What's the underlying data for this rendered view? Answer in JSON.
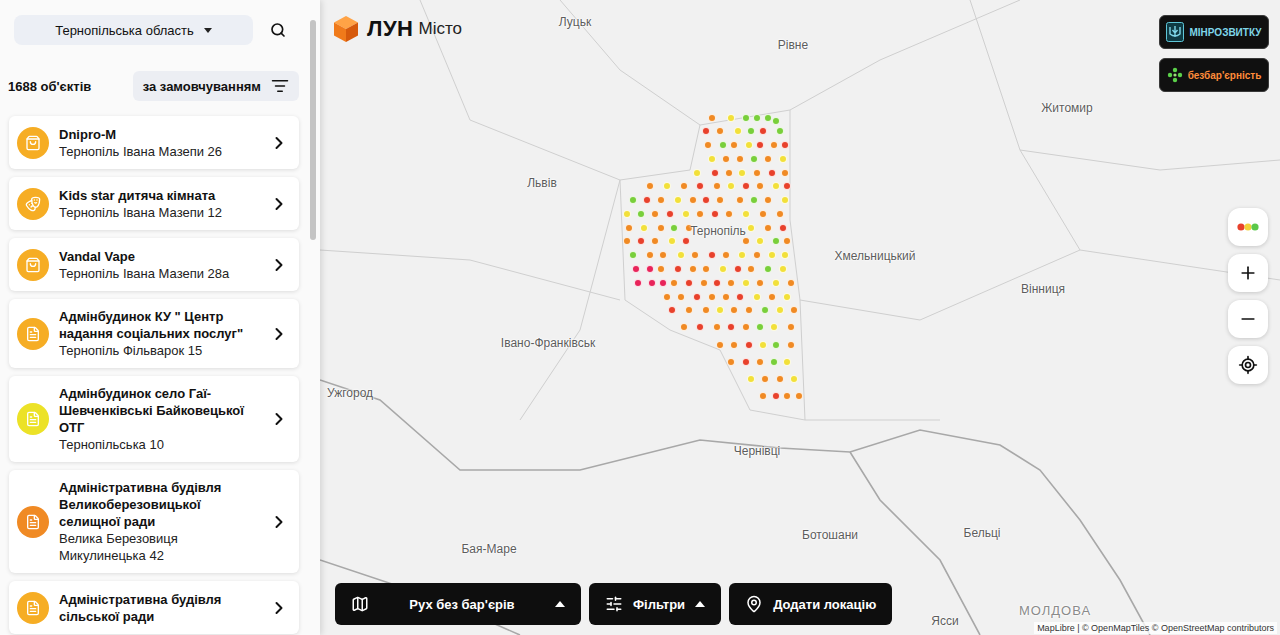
{
  "sidebar": {
    "region_select": {
      "value": "Тернопільська область"
    },
    "count": "1688 об'єктів",
    "sort": {
      "label": "за замовчуванням"
    },
    "items": [
      {
        "title": "Dnipro-M",
        "address": "Тернопіль Івана Мазепи 26",
        "color": "#f6ad24",
        "kind": "shop"
      },
      {
        "title": "Kids star дитяча кімната",
        "address": "Тернопіль Івана Мазепи 12",
        "color": "#f6ad24",
        "kind": "kids"
      },
      {
        "title": "Vandal Vape",
        "address": "Тернопіль Івана Мазепи 28а",
        "color": "#f6ad24",
        "kind": "shop"
      },
      {
        "title": "Адмінбудинок КУ \" Центр надання соціальних послуг\"",
        "address": "Тернопіль Фільварок 15",
        "color": "#f6ad24",
        "kind": "admin"
      },
      {
        "title": "Адмінбудинок село Гаї-Шевченківські Байковецької ОТГ",
        "address": "Тернопільська 10",
        "color": "#ece227",
        "kind": "admin"
      },
      {
        "title": "Адміністративна будівля Великоберезовицької селищної ради",
        "address": "Велика Березовиця Микулинецька 42",
        "color": "#f08a24",
        "kind": "admin"
      },
      {
        "title": "Адміністративна будівля сільської ради",
        "address": "",
        "color": "#f6ad24",
        "kind": "admin"
      }
    ]
  },
  "map": {
    "logo": {
      "brand": "ЛУН",
      "product": "Місто"
    },
    "badges": [
      {
        "label": "МІНРОЗВИТКУ",
        "kind": "ministry"
      },
      {
        "label": "безбар'єрність",
        "kind": "barrierfree"
      }
    ],
    "labels": [
      {
        "text": "Луцьк",
        "kind": "city"
      },
      {
        "text": "Рівне",
        "kind": "city"
      },
      {
        "text": "Житомир",
        "kind": "city"
      },
      {
        "text": "Львів",
        "kind": "city"
      },
      {
        "text": "Тернопіль",
        "kind": "city"
      },
      {
        "text": "Хмельницький",
        "kind": "city"
      },
      {
        "text": "Вінниця",
        "kind": "city"
      },
      {
        "text": "Івано-Франківськ",
        "kind": "city"
      },
      {
        "text": "Ужгород",
        "kind": "city"
      },
      {
        "text": "Чернівці",
        "kind": "city"
      },
      {
        "text": "Бая-Маре",
        "kind": "city"
      },
      {
        "text": "Ботошани",
        "kind": "city"
      },
      {
        "text": "Бельці",
        "kind": "city"
      },
      {
        "text": "Ясси",
        "kind": "city"
      },
      {
        "text": "МОЛДОВА",
        "kind": "country"
      }
    ],
    "dots": [
      {
        "lon": 25.55,
        "lat": 50.22,
        "color": "#f08a24"
      },
      {
        "lon": 25.72,
        "lat": 50.22,
        "color": "#f2e03a"
      },
      {
        "lon": 25.85,
        "lat": 50.22,
        "color": "#79cf3b"
      },
      {
        "lon": 25.95,
        "lat": 50.22,
        "color": "#79cf3b"
      },
      {
        "lon": 26.05,
        "lat": 50.22,
        "color": "#79cf3b"
      },
      {
        "lon": 26.12,
        "lat": 50.2,
        "color": "#79cf3b"
      },
      {
        "lon": 25.5,
        "lat": 50.14,
        "color": "#e8412c"
      },
      {
        "lon": 25.62,
        "lat": 50.14,
        "color": "#f08a24"
      },
      {
        "lon": 25.78,
        "lat": 50.14,
        "color": "#f2e03a"
      },
      {
        "lon": 25.9,
        "lat": 50.14,
        "color": "#79cf3b"
      },
      {
        "lon": 26.0,
        "lat": 50.14,
        "color": "#e8412c"
      },
      {
        "lon": 26.15,
        "lat": 50.14,
        "color": "#79cf3b"
      },
      {
        "lon": 25.52,
        "lat": 50.06,
        "color": "#f08a24"
      },
      {
        "lon": 25.65,
        "lat": 50.06,
        "color": "#79cf3b"
      },
      {
        "lon": 25.75,
        "lat": 50.06,
        "color": "#f08a24"
      },
      {
        "lon": 25.88,
        "lat": 50.06,
        "color": "#f2e03a"
      },
      {
        "lon": 25.98,
        "lat": 50.06,
        "color": "#e8412c"
      },
      {
        "lon": 26.1,
        "lat": 50.06,
        "color": "#f08a24"
      },
      {
        "lon": 26.2,
        "lat": 50.06,
        "color": "#e8412c"
      },
      {
        "lon": 25.55,
        "lat": 49.98,
        "color": "#f2e03a"
      },
      {
        "lon": 25.68,
        "lat": 49.98,
        "color": "#f08a24"
      },
      {
        "lon": 25.8,
        "lat": 49.98,
        "color": "#f08a24"
      },
      {
        "lon": 25.92,
        "lat": 49.98,
        "color": "#79cf3b"
      },
      {
        "lon": 26.05,
        "lat": 49.98,
        "color": "#f08a24"
      },
      {
        "lon": 26.18,
        "lat": 49.98,
        "color": "#f2e03a"
      },
      {
        "lon": 25.42,
        "lat": 49.9,
        "color": "#f2e03a"
      },
      {
        "lon": 25.58,
        "lat": 49.9,
        "color": "#e8412c"
      },
      {
        "lon": 25.7,
        "lat": 49.9,
        "color": "#f08a24"
      },
      {
        "lon": 25.82,
        "lat": 49.9,
        "color": "#f2e03a"
      },
      {
        "lon": 25.95,
        "lat": 49.9,
        "color": "#f08a24"
      },
      {
        "lon": 26.08,
        "lat": 49.9,
        "color": "#e8412c"
      },
      {
        "lon": 26.2,
        "lat": 49.9,
        "color": "#f08a24"
      },
      {
        "lon": 25.0,
        "lat": 49.82,
        "color": "#f08a24"
      },
      {
        "lon": 25.15,
        "lat": 49.82,
        "color": "#f2e03a"
      },
      {
        "lon": 25.3,
        "lat": 49.82,
        "color": "#f08a24"
      },
      {
        "lon": 25.45,
        "lat": 49.82,
        "color": "#e8412c"
      },
      {
        "lon": 25.6,
        "lat": 49.82,
        "color": "#f08a24"
      },
      {
        "lon": 25.72,
        "lat": 49.82,
        "color": "#f2e03a"
      },
      {
        "lon": 25.85,
        "lat": 49.82,
        "color": "#e8412c"
      },
      {
        "lon": 25.98,
        "lat": 49.82,
        "color": "#f08a24"
      },
      {
        "lon": 26.12,
        "lat": 49.82,
        "color": "#f2e03a"
      },
      {
        "lon": 26.22,
        "lat": 49.82,
        "color": "#e8412c"
      },
      {
        "lon": 24.85,
        "lat": 49.74,
        "color": "#79cf3b"
      },
      {
        "lon": 24.98,
        "lat": 49.74,
        "color": "#e8412c"
      },
      {
        "lon": 25.1,
        "lat": 49.74,
        "color": "#f08a24"
      },
      {
        "lon": 25.25,
        "lat": 49.74,
        "color": "#f2e03a"
      },
      {
        "lon": 25.38,
        "lat": 49.74,
        "color": "#f08a24"
      },
      {
        "lon": 25.5,
        "lat": 49.74,
        "color": "#e8412c"
      },
      {
        "lon": 25.62,
        "lat": 49.74,
        "color": "#f08a24"
      },
      {
        "lon": 25.8,
        "lat": 49.74,
        "color": "#f08a24"
      },
      {
        "lon": 25.92,
        "lat": 49.74,
        "color": "#79cf3b"
      },
      {
        "lon": 26.05,
        "lat": 49.74,
        "color": "#f08a24"
      },
      {
        "lon": 26.2,
        "lat": 49.74,
        "color": "#f2e03a"
      },
      {
        "lon": 24.8,
        "lat": 49.66,
        "color": "#f2e03a"
      },
      {
        "lon": 24.92,
        "lat": 49.66,
        "color": "#79cf3b"
      },
      {
        "lon": 25.05,
        "lat": 49.66,
        "color": "#f08a24"
      },
      {
        "lon": 25.18,
        "lat": 49.66,
        "color": "#e8412c"
      },
      {
        "lon": 25.32,
        "lat": 49.66,
        "color": "#f2e03a"
      },
      {
        "lon": 25.45,
        "lat": 49.66,
        "color": "#f08a24"
      },
      {
        "lon": 25.58,
        "lat": 49.66,
        "color": "#e8412c"
      },
      {
        "lon": 25.7,
        "lat": 49.66,
        "color": "#f08a24"
      },
      {
        "lon": 25.85,
        "lat": 49.66,
        "color": "#f2e03a"
      },
      {
        "lon": 26.0,
        "lat": 49.66,
        "color": "#f08a24"
      },
      {
        "lon": 26.15,
        "lat": 49.66,
        "color": "#f08a24"
      },
      {
        "lon": 24.82,
        "lat": 49.58,
        "color": "#f08a24"
      },
      {
        "lon": 24.95,
        "lat": 49.58,
        "color": "#f2e03a"
      },
      {
        "lon": 25.1,
        "lat": 49.58,
        "color": "#f08a24"
      },
      {
        "lon": 25.22,
        "lat": 49.58,
        "color": "#79cf3b"
      },
      {
        "lon": 25.35,
        "lat": 49.58,
        "color": "#f08a24"
      },
      {
        "lon": 25.9,
        "lat": 49.58,
        "color": "#f2e03a"
      },
      {
        "lon": 26.05,
        "lat": 49.58,
        "color": "#f08a24"
      },
      {
        "lon": 26.18,
        "lat": 49.58,
        "color": "#e8412c"
      },
      {
        "lon": 24.8,
        "lat": 49.5,
        "color": "#f08a24"
      },
      {
        "lon": 24.92,
        "lat": 49.5,
        "color": "#e8412c"
      },
      {
        "lon": 25.05,
        "lat": 49.5,
        "color": "#f08a24"
      },
      {
        "lon": 25.2,
        "lat": 49.5,
        "color": "#f2e03a"
      },
      {
        "lon": 25.32,
        "lat": 49.5,
        "color": "#e8412c"
      },
      {
        "lon": 25.85,
        "lat": 49.5,
        "color": "#f08a24"
      },
      {
        "lon": 25.98,
        "lat": 49.5,
        "color": "#f2e03a"
      },
      {
        "lon": 26.12,
        "lat": 49.5,
        "color": "#79cf3b"
      },
      {
        "lon": 26.22,
        "lat": 49.5,
        "color": "#f08a24"
      },
      {
        "lon": 24.85,
        "lat": 49.42,
        "color": "#79cf3b"
      },
      {
        "lon": 25.0,
        "lat": 49.42,
        "color": "#f08a24"
      },
      {
        "lon": 25.12,
        "lat": 49.42,
        "color": "#f08a24"
      },
      {
        "lon": 25.28,
        "lat": 49.42,
        "color": "#f2e03a"
      },
      {
        "lon": 25.4,
        "lat": 49.42,
        "color": "#f08a24"
      },
      {
        "lon": 25.55,
        "lat": 49.42,
        "color": "#e8412c"
      },
      {
        "lon": 25.68,
        "lat": 49.42,
        "color": "#f08a24"
      },
      {
        "lon": 25.82,
        "lat": 49.42,
        "color": "#f2e03a"
      },
      {
        "lon": 25.95,
        "lat": 49.42,
        "color": "#f08a24"
      },
      {
        "lon": 26.08,
        "lat": 49.42,
        "color": "#f2e03a"
      },
      {
        "lon": 26.2,
        "lat": 49.42,
        "color": "#f2e03a"
      },
      {
        "lon": 24.88,
        "lat": 49.34,
        "color": "#e8245a"
      },
      {
        "lon": 25.0,
        "lat": 49.34,
        "color": "#e8245a"
      },
      {
        "lon": 25.1,
        "lat": 49.34,
        "color": "#f08a24"
      },
      {
        "lon": 25.25,
        "lat": 49.34,
        "color": "#e8412c"
      },
      {
        "lon": 25.38,
        "lat": 49.34,
        "color": "#f08a24"
      },
      {
        "lon": 25.5,
        "lat": 49.34,
        "color": "#f08a24"
      },
      {
        "lon": 25.65,
        "lat": 49.34,
        "color": "#f2e03a"
      },
      {
        "lon": 25.78,
        "lat": 49.34,
        "color": "#e8412c"
      },
      {
        "lon": 25.9,
        "lat": 49.34,
        "color": "#f08a24"
      },
      {
        "lon": 26.05,
        "lat": 49.34,
        "color": "#79cf3b"
      },
      {
        "lon": 26.18,
        "lat": 49.34,
        "color": "#f2e03a"
      },
      {
        "lon": 24.9,
        "lat": 49.26,
        "color": "#e8245a"
      },
      {
        "lon": 25.02,
        "lat": 49.26,
        "color": "#e8245a"
      },
      {
        "lon": 25.12,
        "lat": 49.26,
        "color": "#e8245a"
      },
      {
        "lon": 25.22,
        "lat": 49.26,
        "color": "#f08a24"
      },
      {
        "lon": 25.35,
        "lat": 49.26,
        "color": "#e8412c"
      },
      {
        "lon": 25.48,
        "lat": 49.26,
        "color": "#f08a24"
      },
      {
        "lon": 25.6,
        "lat": 49.26,
        "color": "#e8412c"
      },
      {
        "lon": 25.72,
        "lat": 49.26,
        "color": "#f08a24"
      },
      {
        "lon": 25.85,
        "lat": 49.26,
        "color": "#f2e03a"
      },
      {
        "lon": 25.98,
        "lat": 49.26,
        "color": "#f08a24"
      },
      {
        "lon": 26.12,
        "lat": 49.26,
        "color": "#f2e03a"
      },
      {
        "lon": 26.25,
        "lat": 49.26,
        "color": "#f08a24"
      },
      {
        "lon": 25.15,
        "lat": 49.18,
        "color": "#f08a24"
      },
      {
        "lon": 25.28,
        "lat": 49.18,
        "color": "#f08a24"
      },
      {
        "lon": 25.42,
        "lat": 49.18,
        "color": "#e8412c"
      },
      {
        "lon": 25.55,
        "lat": 49.18,
        "color": "#f08a24"
      },
      {
        "lon": 25.68,
        "lat": 49.18,
        "color": "#f08a24"
      },
      {
        "lon": 25.8,
        "lat": 49.18,
        "color": "#e8412c"
      },
      {
        "lon": 25.95,
        "lat": 49.18,
        "color": "#f2e03a"
      },
      {
        "lon": 26.08,
        "lat": 49.18,
        "color": "#f08a24"
      },
      {
        "lon": 26.22,
        "lat": 49.18,
        "color": "#f2e03a"
      },
      {
        "lon": 25.2,
        "lat": 49.1,
        "color": "#e8412c"
      },
      {
        "lon": 25.35,
        "lat": 49.1,
        "color": "#f08a24"
      },
      {
        "lon": 25.5,
        "lat": 49.1,
        "color": "#f08a24"
      },
      {
        "lon": 25.62,
        "lat": 49.1,
        "color": "#f2e03a"
      },
      {
        "lon": 25.75,
        "lat": 49.1,
        "color": "#f08a24"
      },
      {
        "lon": 25.88,
        "lat": 49.1,
        "color": "#f08a24"
      },
      {
        "lon": 26.02,
        "lat": 49.1,
        "color": "#79cf3b"
      },
      {
        "lon": 26.15,
        "lat": 49.1,
        "color": "#f2e03a"
      },
      {
        "lon": 26.28,
        "lat": 49.1,
        "color": "#f08a24"
      },
      {
        "lon": 25.3,
        "lat": 49.0,
        "color": "#f08a24"
      },
      {
        "lon": 25.45,
        "lat": 49.0,
        "color": "#e8412c"
      },
      {
        "lon": 25.6,
        "lat": 49.0,
        "color": "#f08a24"
      },
      {
        "lon": 25.72,
        "lat": 49.0,
        "color": "#e8412c"
      },
      {
        "lon": 25.85,
        "lat": 49.0,
        "color": "#f08a24"
      },
      {
        "lon": 25.98,
        "lat": 49.0,
        "color": "#79cf3b"
      },
      {
        "lon": 26.1,
        "lat": 49.0,
        "color": "#f2e03a"
      },
      {
        "lon": 26.25,
        "lat": 49.0,
        "color": "#f08a24"
      },
      {
        "lon": 25.62,
        "lat": 48.9,
        "color": "#f08a24"
      },
      {
        "lon": 25.75,
        "lat": 48.9,
        "color": "#f08a24"
      },
      {
        "lon": 25.88,
        "lat": 48.9,
        "color": "#e8412c"
      },
      {
        "lon": 26.0,
        "lat": 48.9,
        "color": "#f2e03a"
      },
      {
        "lon": 26.12,
        "lat": 48.9,
        "color": "#79cf3b"
      },
      {
        "lon": 26.25,
        "lat": 48.9,
        "color": "#f08a24"
      },
      {
        "lon": 25.72,
        "lat": 48.8,
        "color": "#f08a24"
      },
      {
        "lon": 25.85,
        "lat": 48.8,
        "color": "#e8412c"
      },
      {
        "lon": 25.98,
        "lat": 48.8,
        "color": "#f08a24"
      },
      {
        "lon": 26.1,
        "lat": 48.8,
        "color": "#79cf3b"
      },
      {
        "lon": 26.22,
        "lat": 48.8,
        "color": "#f2e03a"
      },
      {
        "lon": 25.9,
        "lat": 48.7,
        "color": "#f2e03a"
      },
      {
        "lon": 26.02,
        "lat": 48.7,
        "color": "#f08a24"
      },
      {
        "lon": 26.15,
        "lat": 48.7,
        "color": "#f08a24"
      },
      {
        "lon": 26.28,
        "lat": 48.7,
        "color": "#f2e03a"
      },
      {
        "lon": 26.0,
        "lat": 48.6,
        "color": "#f08a24"
      },
      {
        "lon": 26.12,
        "lat": 48.6,
        "color": "#e8412c"
      },
      {
        "lon": 26.22,
        "lat": 48.6,
        "color": "#f08a24"
      },
      {
        "lon": 26.32,
        "lat": 48.6,
        "color": "#f08a24"
      }
    ],
    "attribution": "MapLibre | © OpenMapTiles © OpenStreetMap contributors"
  },
  "toolbar": [
    {
      "label": "Рух без бар'єрів",
      "kind": "mode"
    },
    {
      "label": "Фільтри",
      "kind": "filters"
    },
    {
      "label": "Додати локацію",
      "kind": "add"
    }
  ]
}
